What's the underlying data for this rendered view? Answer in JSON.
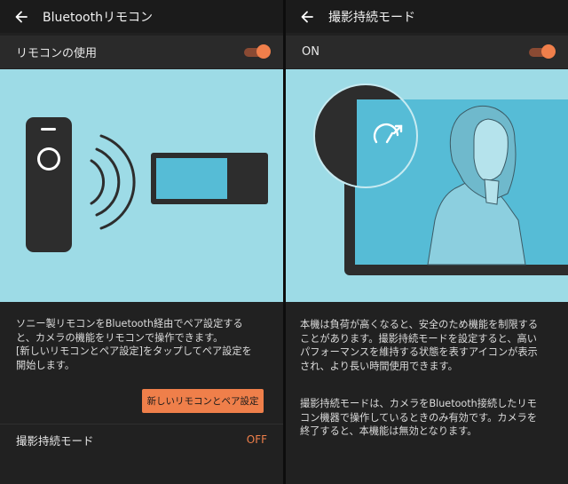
{
  "left": {
    "title": "Bluetoothリモコン",
    "remote_toggle_label": "リモコンの使用",
    "remote_toggle_on": true,
    "description_lines": [
      "ソニー製リモコンをBluetooth経由でペア設定する",
      "と、カメラの機能をリモコンで操作できます。",
      "[新しいリモコンとペア設定]をタップしてペア設定を",
      "開始します。"
    ],
    "pair_button_label": "新しいリモコンとペア設定",
    "continuous_mode_label": "撮影持続モード",
    "continuous_mode_value": "OFF"
  },
  "right": {
    "title": "撮影持続モード",
    "toggle_label": "ON",
    "toggle_on": true,
    "paragraph1_lines": [
      "本機は負荷が高くなると、安全のため機能を制限する",
      "ことがあります。撮影持続モードを設定すると、高い",
      "パフォーマンスを維持する状態を表すアイコンが表示",
      "され、より長い時間使用できます。"
    ],
    "paragraph2_lines": [
      "撮影持続モードは、カメラをBluetooth接続したリモ",
      "コン機器で操作しているときのみ有効です。カメラを",
      "終了すると、本機能は無効となります。"
    ]
  },
  "colors": {
    "accent": "#ef7f4a",
    "background": "#212121",
    "illustration_bg": "#9ddbe6",
    "screen_blue": "#56bcd6"
  },
  "icons": {
    "back": "arrow-left-icon",
    "performance": "speedometer-arrow-icon"
  }
}
